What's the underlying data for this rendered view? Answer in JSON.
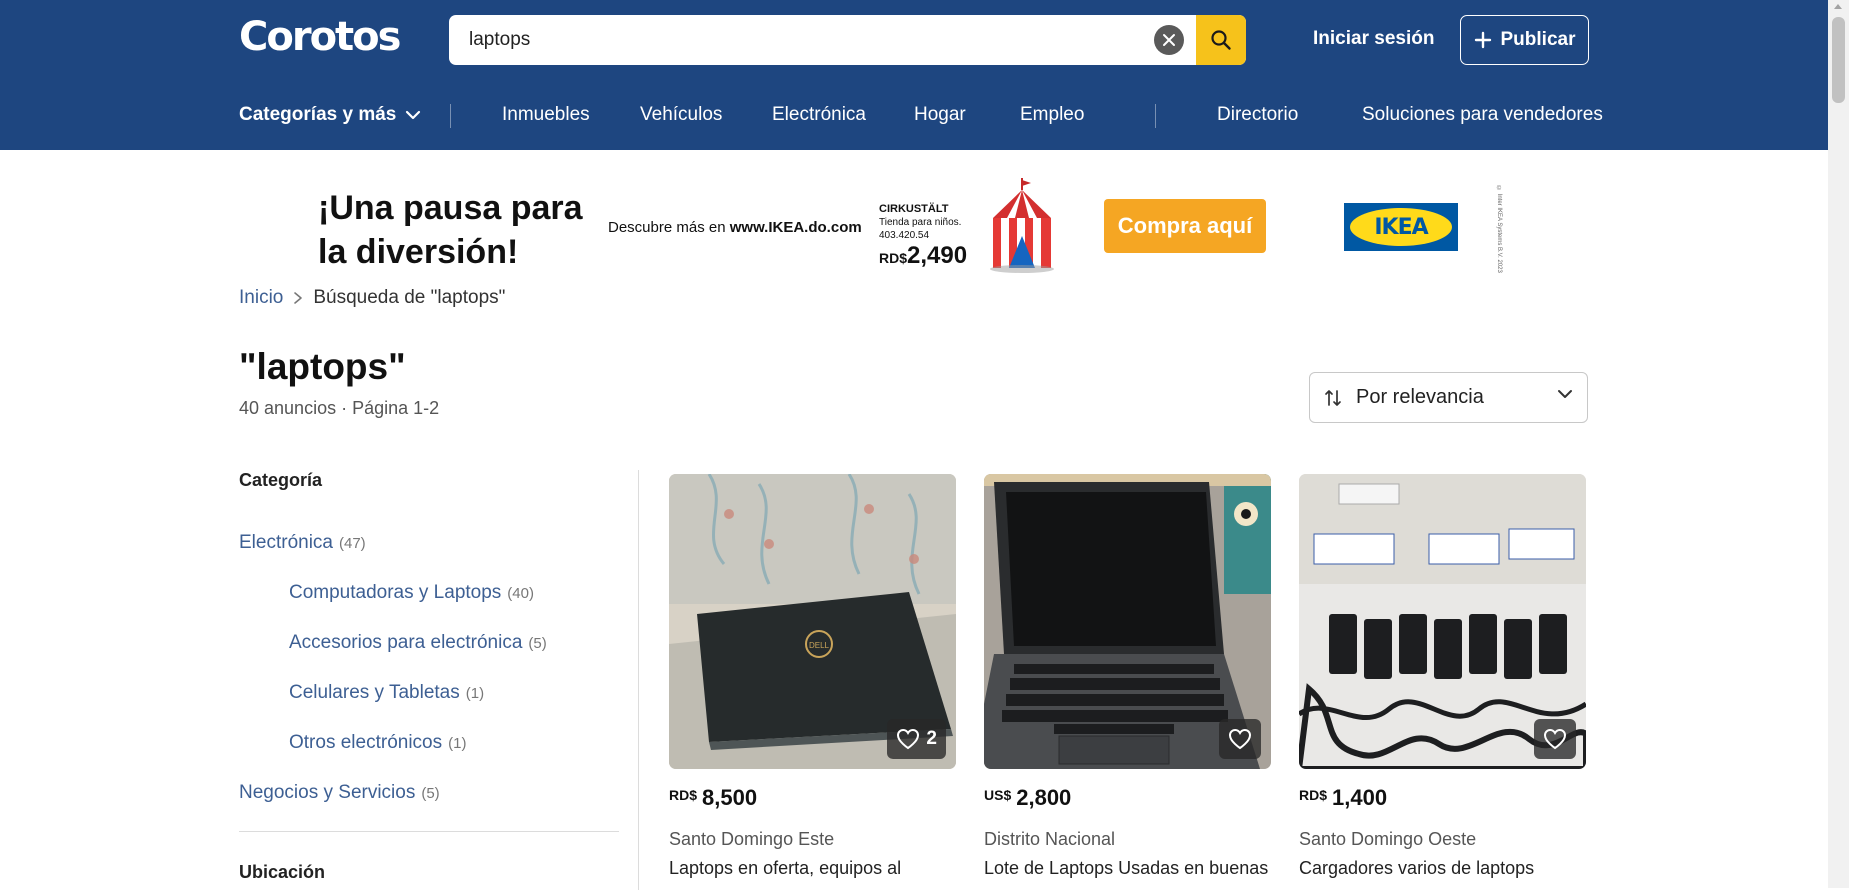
{
  "header": {
    "logo": "Corotos",
    "search_value": "laptops",
    "login_label": "Iniciar sesión",
    "publish_label": "Publicar"
  },
  "nav": {
    "categories_label": "Categorías y más",
    "items": [
      "Inmuebles",
      "Vehículos",
      "Electrónica",
      "Hogar",
      "Empleo"
    ],
    "right_items": [
      "Directorio",
      "Soluciones para vendedores"
    ]
  },
  "banner": {
    "headline_line1": "¡Una pausa para",
    "headline_line2": "la diversión!",
    "discover_prefix": "Descubre más en ",
    "discover_site": "www.IKEA.do.com",
    "product_name": "CIRKUSTÄLT",
    "product_desc": "Tienda para niños.",
    "product_code": "403.420.54",
    "product_currency": "RD$",
    "product_price": "2,490",
    "cta_label": "Compra aquí",
    "brand_logo": "IKEA",
    "legal": "© Inter IKEA Systems B.V. 2023"
  },
  "breadcrumb": {
    "home": "Inicio",
    "current": "Búsqueda de \"laptops\""
  },
  "page": {
    "title": "\"laptops\"",
    "results": "40 anuncios · Página 1-2"
  },
  "sort": {
    "label": "Por relevancia"
  },
  "filters": {
    "category_heading": "Categoría",
    "categories": [
      {
        "label": "Electrónica",
        "count": "(47)"
      },
      {
        "label": "Computadoras y Laptops",
        "count": "(40)"
      },
      {
        "label": "Accesorios para electrónica",
        "count": "(5)"
      },
      {
        "label": "Celulares y Tabletas",
        "count": "(1)"
      },
      {
        "label": "Otros electrónicos",
        "count": "(1)"
      },
      {
        "label": "Negocios y Servicios",
        "count": "(5)"
      }
    ],
    "location_heading": "Ubicación"
  },
  "listings": [
    {
      "currency": "RD$",
      "price": "8,500",
      "location": "Santo Domingo Este",
      "title": "Laptops en oferta, equipos al",
      "favorites": "2"
    },
    {
      "currency": "US$",
      "price": "2,800",
      "location": "Distrito Nacional",
      "title": "Lote de Laptops Usadas en buenas",
      "favorites": ""
    },
    {
      "currency": "RD$",
      "price": "1,400",
      "location": "Santo Domingo Oeste",
      "title": "Cargadores varios de laptops",
      "favorites": ""
    }
  ],
  "colors": {
    "header_bg": "#1e4680",
    "search_button": "#f6c21b",
    "link": "#3d5f93",
    "cta": "#f5a623",
    "ikea_blue": "#0058a3",
    "ikea_yellow": "#ffda1a"
  },
  "icons": [
    "search-icon",
    "clear-icon",
    "plus-icon",
    "chevron-down-icon",
    "chevron-right-icon",
    "sort-icon",
    "heart-icon"
  ]
}
